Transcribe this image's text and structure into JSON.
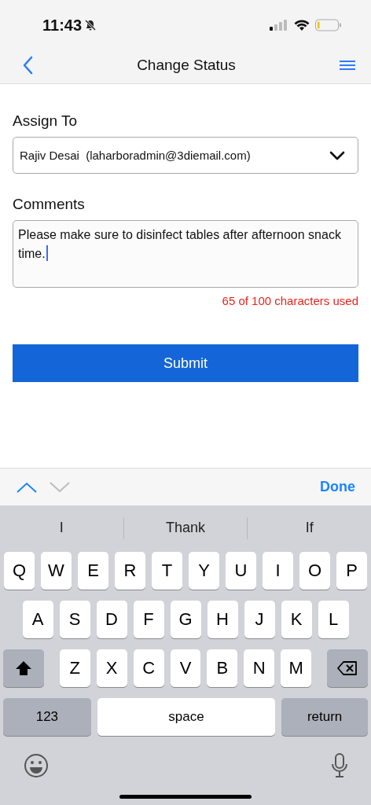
{
  "status_bar": {
    "time": "11:43"
  },
  "nav": {
    "title": "Change Status"
  },
  "form": {
    "assign_label": "Assign To",
    "assign_value": "Rajiv Desai  (laharboradmin@3diemail.com)",
    "comments_label": "Comments",
    "comments_value": "Please make sure to disinfect tables after afternoon snack time.",
    "counter": "65 of 100 characters used",
    "submit": "Submit"
  },
  "accessory": {
    "prev": {
      "disabled": false
    },
    "next": {
      "disabled": true
    },
    "done": "Done"
  },
  "suggestions": [
    "I",
    "Thank",
    "If"
  ],
  "keyboard": {
    "rows": [
      [
        "Q",
        "W",
        "E",
        "R",
        "T",
        "Y",
        "U",
        "I",
        "O",
        "P"
      ],
      [
        "A",
        "S",
        "D",
        "F",
        "G",
        "H",
        "J",
        "K",
        "L"
      ],
      [
        "Z",
        "X",
        "C",
        "V",
        "B",
        "N",
        "M"
      ]
    ],
    "numbers": "123",
    "space": "space",
    "return": "return"
  }
}
